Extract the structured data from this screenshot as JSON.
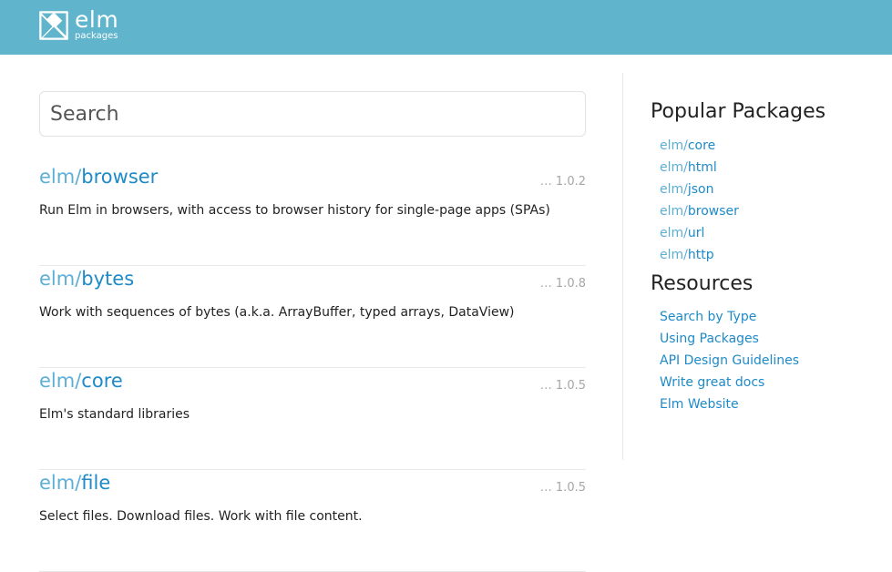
{
  "header": {
    "logo_name": "elm",
    "logo_sub": "packages"
  },
  "search": {
    "placeholder": "Search",
    "value": ""
  },
  "packages": [
    {
      "author": "elm/",
      "project": "browser",
      "version": "… 1.0.2",
      "summary": "Run Elm in browsers, with access to browser history for single-page apps (SPAs)"
    },
    {
      "author": "elm/",
      "project": "bytes",
      "version": "… 1.0.8",
      "summary": "Work with sequences of bytes (a.k.a. ArrayBuffer, typed arrays, DataView)"
    },
    {
      "author": "elm/",
      "project": "core",
      "version": "… 1.0.5",
      "summary": "Elm's standard libraries"
    },
    {
      "author": "elm/",
      "project": "file",
      "version": "… 1.0.5",
      "summary": "Select files. Download files. Work with file content."
    }
  ],
  "sidebar": {
    "popular_heading": "Popular Packages",
    "popular": [
      {
        "author": "elm/",
        "project": "core"
      },
      {
        "author": "elm/",
        "project": "html"
      },
      {
        "author": "elm/",
        "project": "json"
      },
      {
        "author": "elm/",
        "project": "browser"
      },
      {
        "author": "elm/",
        "project": "url"
      },
      {
        "author": "elm/",
        "project": "http"
      }
    ],
    "resources_heading": "Resources",
    "resources": [
      "Search by Type",
      "Using Packages",
      "API Design Guidelines",
      "Write great docs",
      "Elm Website"
    ]
  },
  "colors": {
    "header_bg": "#60b5cc",
    "author_link": "#5eaed6",
    "project_link": "#1e8ac8"
  }
}
